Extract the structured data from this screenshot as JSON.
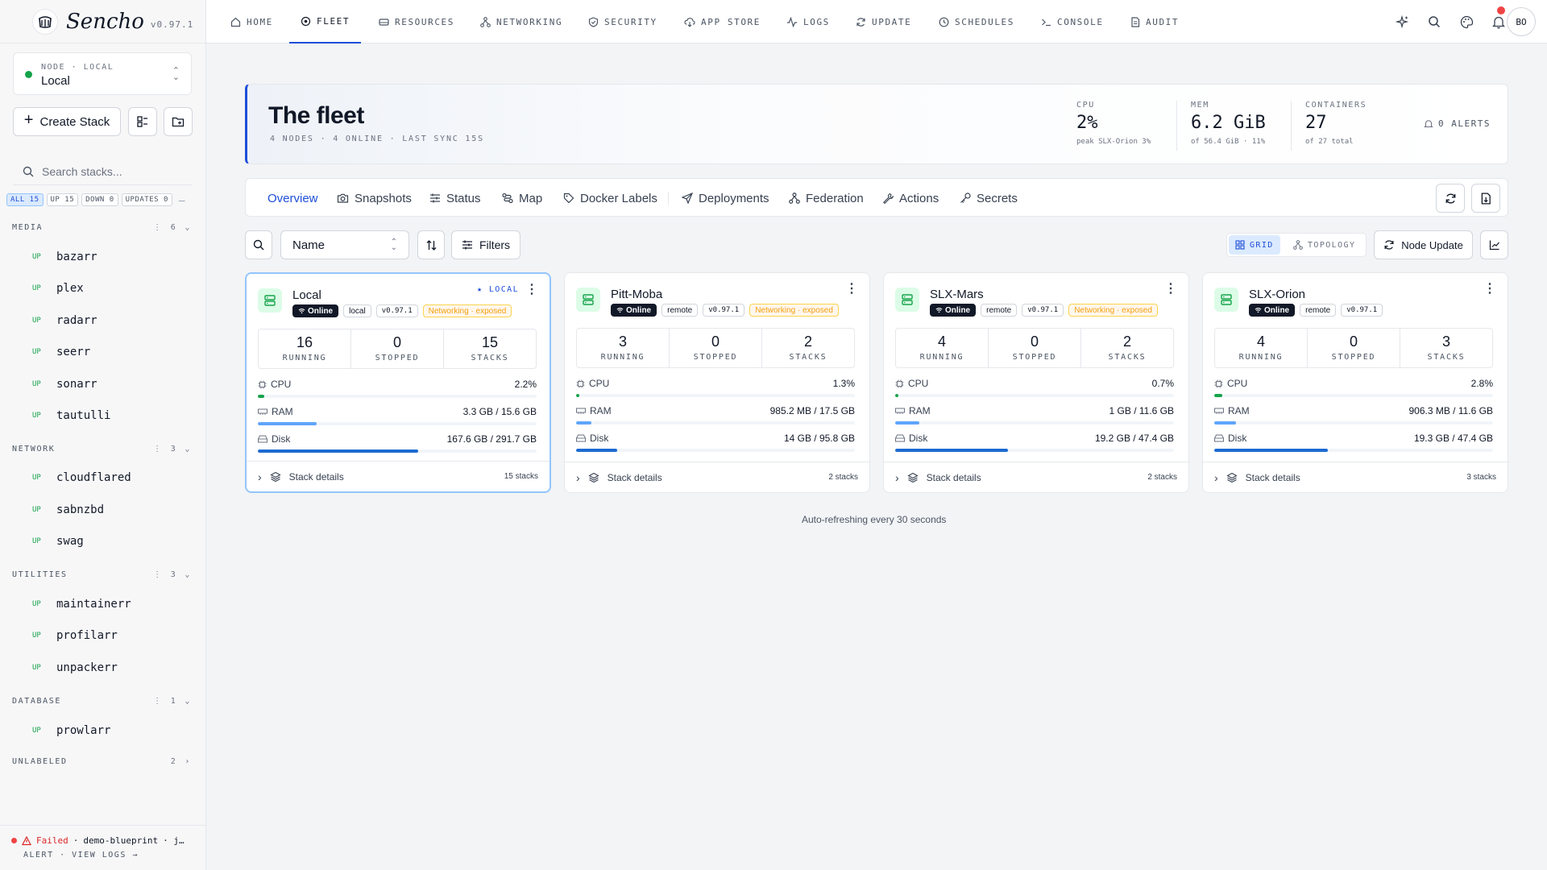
{
  "brand": {
    "name": "Sencho",
    "version": "v0.97.1"
  },
  "node_selector": {
    "label": "NODE · LOCAL",
    "value": "Local"
  },
  "sidebar": {
    "create_label": "Create Stack",
    "search_placeholder": "Search stacks...",
    "chips": [
      "ALL 15",
      "UP 15",
      "DOWN 0",
      "UPDATES 0"
    ],
    "chip_dash": "–",
    "groups": [
      {
        "name": "MEDIA",
        "count": "6",
        "open": true,
        "stacks": [
          {
            "status": "UP",
            "name": "bazarr"
          },
          {
            "status": "UP",
            "name": "plex"
          },
          {
            "status": "UP",
            "name": "radarr"
          },
          {
            "status": "UP",
            "name": "seerr"
          },
          {
            "status": "UP",
            "name": "sonarr"
          },
          {
            "status": "UP",
            "name": "tautulli"
          }
        ]
      },
      {
        "name": "NETWORK",
        "count": "3",
        "open": true,
        "stacks": [
          {
            "status": "UP",
            "name": "cloudflared"
          },
          {
            "status": "UP",
            "name": "sabnzbd"
          },
          {
            "status": "UP",
            "name": "swag"
          }
        ]
      },
      {
        "name": "UTILITIES",
        "count": "3",
        "open": true,
        "stacks": [
          {
            "status": "UP",
            "name": "maintainerr"
          },
          {
            "status": "UP",
            "name": "profilarr"
          },
          {
            "status": "UP",
            "name": "unpackerr"
          }
        ]
      },
      {
        "name": "DATABASE",
        "count": "1",
        "open": true,
        "stacks": [
          {
            "status": "UP",
            "name": "prowlarr"
          }
        ]
      },
      {
        "name": "UNLABELED",
        "count": "2",
        "open": false,
        "stacks": []
      }
    ],
    "alert": {
      "state": "Failed",
      "sep": "·",
      "target": "demo-blueprint",
      "tail": "· j…",
      "actions": "ALERT · VIEW LOGS →"
    }
  },
  "nav": {
    "items": [
      "HOME",
      "FLEET",
      "RESOURCES",
      "NETWORKING",
      "SECURITY",
      "APP STORE",
      "LOGS",
      "UPDATE",
      "SCHEDULES",
      "CONSOLE",
      "AUDIT"
    ],
    "active": "FLEET",
    "avatar": "BO"
  },
  "fleet_header": {
    "title": "The fleet",
    "subtitle": "4 NODES · 4 ONLINE · LAST SYNC 15S",
    "cpu": {
      "label": "CPU",
      "value": "2%",
      "sub": "peak SLX-Orion 3%"
    },
    "mem": {
      "label": "MEM",
      "value": "6.2 GiB",
      "sub": "of 56.4 GiB · 11%"
    },
    "containers": {
      "label": "CONTAINERS",
      "value": "27",
      "sub": "of 27 total"
    },
    "alerts": "0 ALERTS"
  },
  "tabs": [
    "Overview",
    "Snapshots",
    "Status",
    "Map",
    "Docker Labels",
    "Deployments",
    "Federation",
    "Actions",
    "Secrets"
  ],
  "toolbar": {
    "sort_value": "Name",
    "filters_label": "Filters",
    "view_grid": "GRID",
    "view_topology": "TOPOLOGY",
    "node_update_label": "Node Update"
  },
  "nodes": [
    {
      "name": "Local",
      "local_tag": "★ LOCAL",
      "status": "Online",
      "type": "local",
      "version": "v0.97.1",
      "exposed": "Networking · exposed",
      "running": "16",
      "stopped": "0",
      "stacks": "15",
      "running_label": "RUNNING",
      "stopped_label": "STOPPED",
      "stacks_label": "STACKS",
      "cpu": "2.2%",
      "cpu_pct": 2.2,
      "ram": "3.3 GB / 15.6 GB",
      "ram_pct": 21.2,
      "disk": "167.6 GB / 291.7 GB",
      "disk_pct": 57.5,
      "details": "Stack details",
      "stack_count": "15 stacks"
    },
    {
      "name": "Pitt-Moba",
      "local_tag": "",
      "status": "Online",
      "type": "remote",
      "version": "v0.97.1",
      "exposed": "Networking · exposed",
      "running": "3",
      "stopped": "0",
      "stacks": "2",
      "running_label": "RUNNING",
      "stopped_label": "STOPPED",
      "stacks_label": "STACKS",
      "cpu": "1.3%",
      "cpu_pct": 1.3,
      "ram": "985.2 MB / 17.5 GB",
      "ram_pct": 5.6,
      "disk": "14 GB / 95.8 GB",
      "disk_pct": 14.6,
      "details": "Stack details",
      "stack_count": "2 stacks"
    },
    {
      "name": "SLX-Mars",
      "local_tag": "",
      "status": "Online",
      "type": "remote",
      "version": "v0.97.1",
      "exposed": "Networking · exposed",
      "running": "4",
      "stopped": "0",
      "stacks": "2",
      "running_label": "RUNNING",
      "stopped_label": "STOPPED",
      "stacks_label": "STACKS",
      "cpu": "0.7%",
      "cpu_pct": 0.7,
      "ram": "1 GB / 11.6 GB",
      "ram_pct": 8.6,
      "disk": "19.2 GB / 47.4 GB",
      "disk_pct": 40.5,
      "details": "Stack details",
      "stack_count": "2 stacks"
    },
    {
      "name": "SLX-Orion",
      "local_tag": "",
      "status": "Online",
      "type": "remote",
      "version": "v0.97.1",
      "exposed": "",
      "running": "4",
      "stopped": "0",
      "stacks": "3",
      "running_label": "RUNNING",
      "stopped_label": "STOPPED",
      "stacks_label": "STACKS",
      "cpu": "2.8%",
      "cpu_pct": 2.8,
      "ram": "906.3 MB / 11.6 GB",
      "ram_pct": 7.8,
      "disk": "19.3 GB / 47.4 GB",
      "disk_pct": 40.7,
      "details": "Stack details",
      "stack_count": "3 stacks"
    }
  ],
  "metric_labels": {
    "cpu": "CPU",
    "ram": "RAM",
    "disk": "Disk"
  },
  "colors": {
    "accent": "#1d4ed8",
    "online": "#16a34a",
    "cpu_bar": "#16a34a",
    "ram_bar": "#60a5fa",
    "disk_bar": "#1d6bd1",
    "exposed": "#f59e0b",
    "alert_red": "#dc2626"
  },
  "autorefresh": "Auto-refreshing every 30 seconds"
}
